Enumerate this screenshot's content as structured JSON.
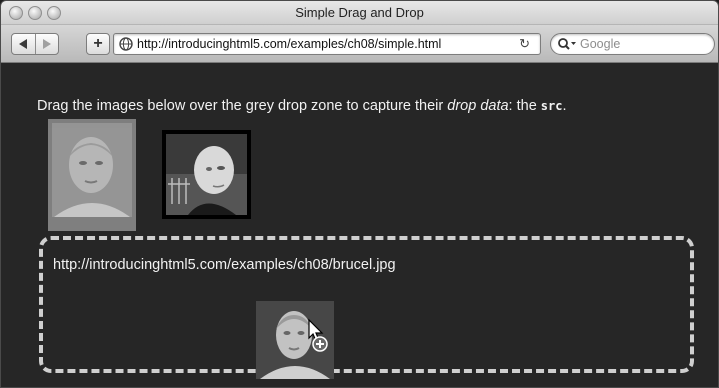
{
  "window": {
    "title": "Simple Drag and Drop"
  },
  "toolbar": {
    "back_icon": "back-arrow-icon",
    "forward_icon": "forward-arrow-icon",
    "add_label": "+",
    "url": "http://introducinghtml5.com/examples/ch08/simple.html",
    "search_placeholder": "Google"
  },
  "page": {
    "instructions_prefix": "Drag the images below over the grey drop zone to capture their ",
    "instructions_em": "drop data",
    "instructions_mid": ": the ",
    "instructions_code": "src",
    "instructions_suffix": ".",
    "images": [
      {
        "alt": "photo of Bruce (being dragged)"
      },
      {
        "alt": "photo of Remy"
      }
    ],
    "drop_data": "http://introducinghtml5.com/examples/ch08/brucel.jpg"
  }
}
